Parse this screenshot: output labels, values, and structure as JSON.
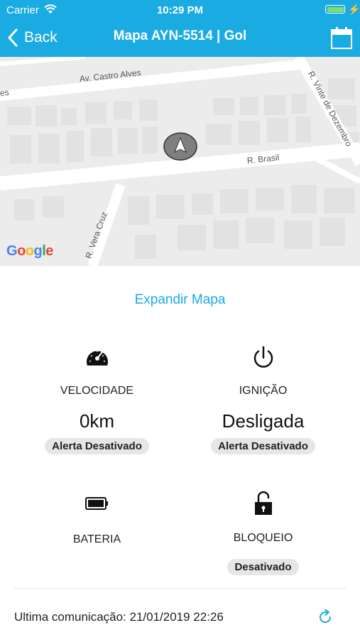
{
  "status_bar": {
    "carrier": "Carrier",
    "time": "10:29 PM",
    "wifi_icon": "wifi-icon",
    "battery_icon": "battery-icon"
  },
  "nav": {
    "back_label": "Back",
    "title": "Mapa AYN-5514 | Gol",
    "calendar_icon": "calendar-icon"
  },
  "map": {
    "streets": [
      "Av. Castro Alves",
      "R. Vinte de Dezembro",
      "R. Brasil",
      "R. Vera Cruz",
      "es"
    ],
    "provider": "Google",
    "marker_icon": "navigation-arrow-icon"
  },
  "expand_map": "Expandir Mapa",
  "cards": {
    "velocidade": {
      "icon": "speedometer-icon",
      "label": "VELOCIDADE",
      "value": "0km",
      "alert": "Alerta Desativado"
    },
    "ignicao": {
      "icon": "power-icon",
      "label": "IGNIÇÃO",
      "value": "Desligada",
      "alert": "Alerta Desativado"
    },
    "bateria": {
      "icon": "battery-icon",
      "label": "BATERIA"
    },
    "bloqueio": {
      "icon": "padlock-icon",
      "label": "BLOQUEIO",
      "status": "Desativado"
    }
  },
  "footer": {
    "last_comm": "Ultima comunicação: 21/01/2019 22:26",
    "refresh_icon": "refresh-icon"
  },
  "colors": {
    "accent": "#1aabe3",
    "map_bg": "#ececec",
    "pill_bg": "#e6e6e6"
  }
}
